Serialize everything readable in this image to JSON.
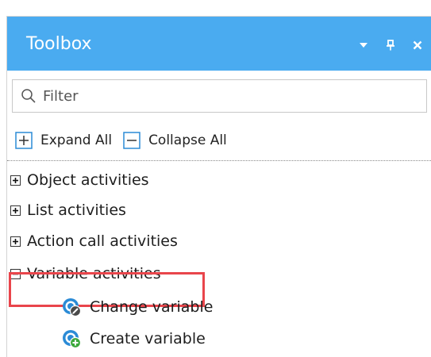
{
  "panel": {
    "title": "Toolbox"
  },
  "title_controls": {
    "dropdown_icon": "chevron-down-icon",
    "pin_icon": "pin-icon",
    "close_icon": "close-icon"
  },
  "filter": {
    "placeholder": "Filter",
    "value": ""
  },
  "actions": {
    "expand_all_label": "Expand All",
    "collapse_all_label": "Collapse All"
  },
  "tree": {
    "items": [
      {
        "label": "Object activities",
        "state": "collapsed"
      },
      {
        "label": "List activities",
        "state": "collapsed"
      },
      {
        "label": "Action call activities",
        "state": "collapsed"
      },
      {
        "label": "Variable activities",
        "state": "expanded"
      }
    ],
    "children": [
      {
        "label": "Change variable",
        "icon": "change-variable-icon"
      },
      {
        "label": "Create variable",
        "icon": "create-variable-icon"
      }
    ]
  },
  "colors": {
    "title_bar": "#4aabf0",
    "highlight": "#e9454b",
    "icon_blue": "#2b8bd6",
    "icon_green": "#3ca83c"
  }
}
